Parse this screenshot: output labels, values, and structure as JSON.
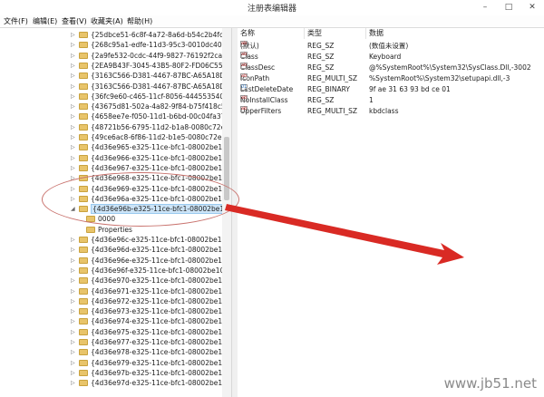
{
  "window": {
    "title": "注册表编辑器",
    "minimize": "–",
    "maximize": "□",
    "close": "✕"
  },
  "menu": [
    {
      "label": "文件(F)"
    },
    {
      "label": "编辑(E)"
    },
    {
      "label": "查看(V)"
    },
    {
      "label": "收藏夹(A)"
    },
    {
      "label": "帮助(H)"
    }
  ],
  "tree": [
    {
      "label": "{25dbce51-6c8f-4a72-8a6d-b54c2b4fc835}",
      "level": 1
    },
    {
      "label": "{268c95a1-edfe-11d3-95c3-0010dc4050a5}",
      "level": 1
    },
    {
      "label": "{2a9fe532-0cdc-44f9-9827-76192f2ca2fb}",
      "level": 1
    },
    {
      "label": "{2EA9B43F-3045-43B5-80F2-FD06C55FBB90}",
      "level": 1
    },
    {
      "label": "{3163C566-D381-4467-87BC-A65A18D5B648}",
      "level": 1
    },
    {
      "label": "{3163C566-D381-4467-87BC-A65A18D5B649}",
      "level": 1
    },
    {
      "label": "{36fc9e60-c465-11cf-8056-444553540000}",
      "level": 1
    },
    {
      "label": "{43675d81-502a-4a82-9f84-b75f418c5dea}",
      "level": 1
    },
    {
      "label": "{4658ee7e-f050-11d1-b6bd-00c04fa372a7}",
      "level": 1
    },
    {
      "label": "{48721b56-6795-11d2-b1a8-0080c72e74a2}",
      "level": 1
    },
    {
      "label": "{49ce6ac8-6f86-11d2-b1e5-0080c72e74a2}",
      "level": 1
    },
    {
      "label": "{4d36e965-e325-11ce-bfc1-08002be10318}",
      "level": 1
    },
    {
      "label": "{4d36e966-e325-11ce-bfc1-08002be10318}",
      "level": 1
    },
    {
      "label": "{4d36e967-e325-11ce-bfc1-08002be10318}",
      "level": 1
    },
    {
      "label": "{4d36e968-e325-11ce-bfc1-08002be10318}",
      "level": 1
    },
    {
      "label": "{4d36e969-e325-11ce-bfc1-08002be10318}",
      "level": 1
    },
    {
      "label": "{4d36e96a-e325-11ce-bfc1-08002be10318}",
      "level": 1
    },
    {
      "label": "{4d36e96b-e325-11ce-bfc1-08002be10318}",
      "level": 1,
      "selected": true,
      "expanded": true
    },
    {
      "label": "0000",
      "level": 2
    },
    {
      "label": "Properties",
      "level": 2
    },
    {
      "label": "{4d36e96c-e325-11ce-bfc1-08002be10318}",
      "level": 1
    },
    {
      "label": "{4d36e96d-e325-11ce-bfc1-08002be10318}",
      "level": 1
    },
    {
      "label": "{4d36e96e-e325-11ce-bfc1-08002be10318}",
      "level": 1
    },
    {
      "label": "{4d36e96f-e325-11ce-bfc1-08002be10318}",
      "level": 1
    },
    {
      "label": "{4d36e970-e325-11ce-bfc1-08002be10318}",
      "level": 1
    },
    {
      "label": "{4d36e971-e325-11ce-bfc1-08002be10318}",
      "level": 1
    },
    {
      "label": "{4d36e972-e325-11ce-bfc1-08002be10318}",
      "level": 1
    },
    {
      "label": "{4d36e973-e325-11ce-bfc1-08002be10318}",
      "level": 1
    },
    {
      "label": "{4d36e974-e325-11ce-bfc1-08002be10318}",
      "level": 1
    },
    {
      "label": "{4d36e975-e325-11ce-bfc1-08002be10318}",
      "level": 1
    },
    {
      "label": "{4d36e977-e325-11ce-bfc1-08002be10318}",
      "level": 1
    },
    {
      "label": "{4d36e978-e325-11ce-bfc1-08002be10318}",
      "level": 1
    },
    {
      "label": "{4d36e979-e325-11ce-bfc1-08002be10318}",
      "level": 1
    },
    {
      "label": "{4d36e97b-e325-11ce-bfc1-08002be10318}",
      "level": 1
    },
    {
      "label": "{4d36e97d-e325-11ce-bfc1-08002be10318}",
      "level": 1
    }
  ],
  "columns": {
    "name": "名称",
    "type": "类型",
    "data": "数据"
  },
  "values": [
    {
      "icon": "ab",
      "name": "(默认)",
      "type": "REG_SZ",
      "data": "(数值未设置)"
    },
    {
      "icon": "ab",
      "name": "Class",
      "type": "REG_SZ",
      "data": "Keyboard"
    },
    {
      "icon": "ab",
      "name": "ClassDesc",
      "type": "REG_SZ",
      "data": "@%SystemRoot%\\System32\\SysClass.Dll,-3002"
    },
    {
      "icon": "ab",
      "name": "IconPath",
      "type": "REG_MULTI_SZ",
      "data": "%SystemRoot%\\System32\\setupapi.dll,-3"
    },
    {
      "icon": "bin",
      "name": "LastDeleteDate",
      "type": "REG_BINARY",
      "data": "9f ae 31 63 93 bd ce 01"
    },
    {
      "icon": "ab",
      "name": "NoInstallClass",
      "type": "REG_SZ",
      "data": "1"
    },
    {
      "icon": "ab",
      "name": "UpperFilters",
      "type": "REG_MULTI_SZ",
      "data": "kbdclass"
    }
  ],
  "watermark": "www.jb51.net",
  "colors": {
    "selection": "#cce4f7",
    "annotation_red": "#d92a24",
    "folder": "#e8c46a"
  }
}
